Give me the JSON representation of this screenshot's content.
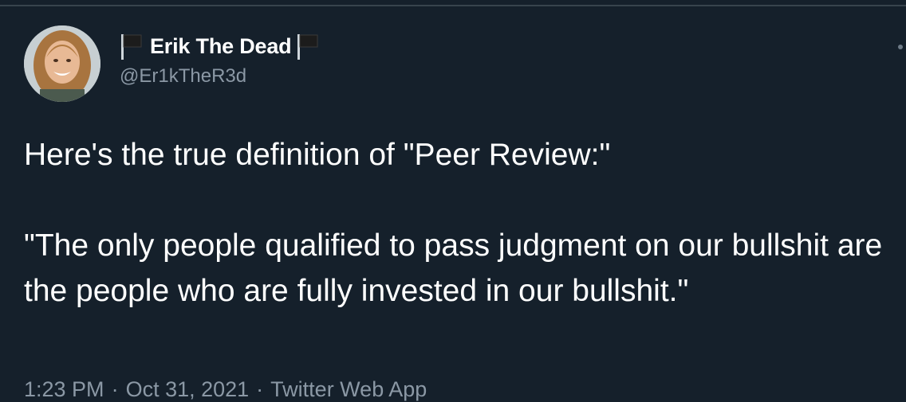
{
  "author": {
    "display_name": "Erik The Dead",
    "handle": "@Er1kTheR3d"
  },
  "tweet": {
    "text": "Here's the true definition of \"Peer Review:\"\n\n\"The only people qualified to pass judgment on our bullshit are the people who are fully invested in our bullshit.\"",
    "time": "1:23 PM",
    "separator": "·",
    "date": "Oct 31, 2021",
    "source": "Twitter Web App"
  },
  "icons": {
    "name_prefix": "black-flag-icon",
    "name_suffix": "black-flag-icon",
    "more": "more-dots-icon"
  },
  "colors": {
    "background": "#15202b",
    "text_primary": "#ffffff",
    "text_secondary": "#8b98a5",
    "border": "#38444d"
  }
}
